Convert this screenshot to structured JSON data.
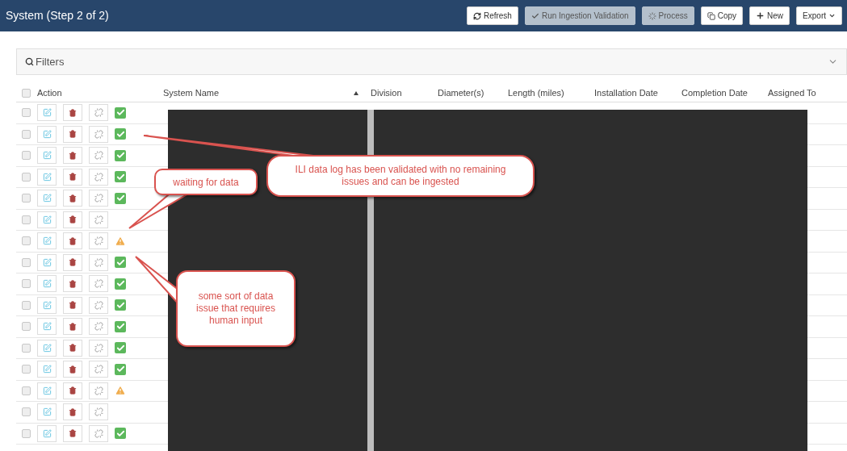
{
  "header": {
    "title": "System (Step 2 of 2)"
  },
  "toolbar": [
    {
      "label": "Refresh",
      "kind": "refresh",
      "disabled": false
    },
    {
      "label": "Run Ingestion Validation",
      "kind": "validate",
      "disabled": true
    },
    {
      "label": "Process",
      "kind": "process",
      "disabled": true
    },
    {
      "label": "Copy",
      "kind": "copy",
      "disabled": false
    },
    {
      "label": "New",
      "kind": "new",
      "disabled": false
    },
    {
      "label": "Export",
      "kind": "export",
      "disabled": false
    }
  ],
  "filters": {
    "label": "Filters",
    "expanded": false
  },
  "table": {
    "select_all": {
      "checked": false
    },
    "columns": [
      {
        "label": "Action",
        "sorted": false
      },
      {
        "label": "System Name",
        "sorted": true
      },
      {
        "label": "Division",
        "sorted": false
      },
      {
        "label": "Diameter(s)",
        "sorted": false
      },
      {
        "label": "Length (miles)",
        "sorted": false
      },
      {
        "label": "Installation Date",
        "sorted": false
      },
      {
        "label": "Completion Date",
        "sorted": false
      },
      {
        "label": "Assigned To",
        "sorted": false
      }
    ],
    "rows": [
      {
        "checked": false,
        "validated": true,
        "warning": false
      },
      {
        "checked": false,
        "validated": true,
        "warning": false
      },
      {
        "checked": false,
        "validated": true,
        "warning": false
      },
      {
        "checked": false,
        "validated": true,
        "warning": false
      },
      {
        "checked": false,
        "validated": true,
        "warning": false
      },
      {
        "checked": false,
        "validated": false,
        "warning": false
      },
      {
        "checked": false,
        "validated": false,
        "warning": true
      },
      {
        "checked": false,
        "validated": true,
        "warning": false
      },
      {
        "checked": false,
        "validated": true,
        "warning": false
      },
      {
        "checked": false,
        "validated": true,
        "warning": false
      },
      {
        "checked": false,
        "validated": true,
        "warning": false
      },
      {
        "checked": false,
        "validated": true,
        "warning": false
      },
      {
        "checked": false,
        "validated": true,
        "warning": false
      },
      {
        "checked": false,
        "validated": false,
        "warning": true
      },
      {
        "checked": false,
        "validated": false,
        "warning": false
      },
      {
        "checked": false,
        "validated": true,
        "warning": false
      }
    ]
  },
  "callouts": [
    {
      "text": "waiting for data"
    },
    {
      "text": "ILI data log has been validated with no remaining issues and can be ingested"
    },
    {
      "text": "some sort of data issue that requires human input"
    }
  ]
}
